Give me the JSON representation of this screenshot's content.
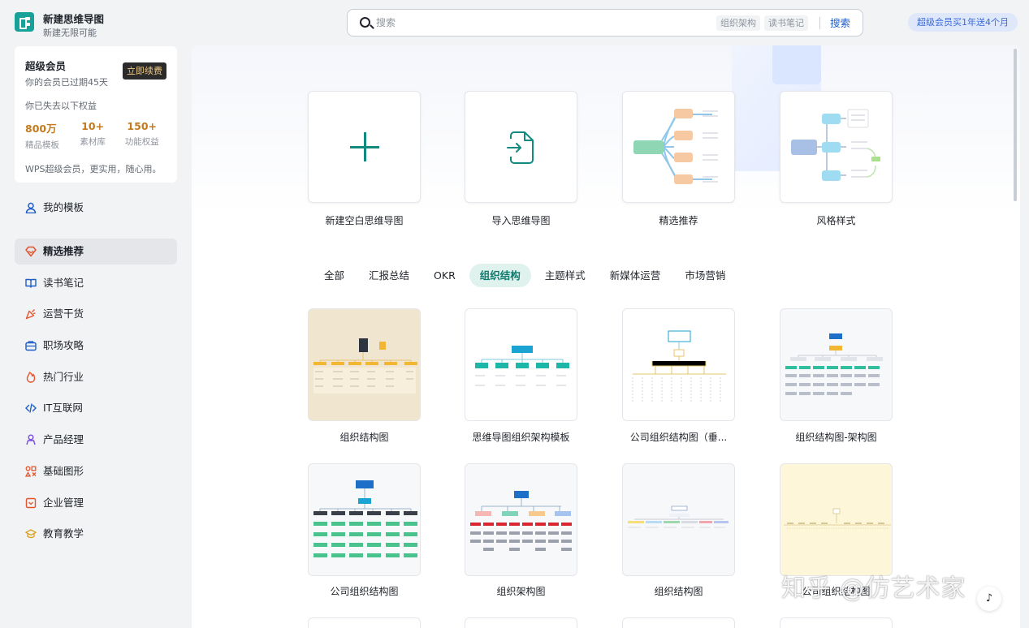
{
  "app": {
    "title": "新建思维导图",
    "subtitle": "新建无限可能"
  },
  "search": {
    "placeholder": "搜索",
    "tags": [
      "组织架构",
      "读书笔记"
    ],
    "button": "搜索"
  },
  "promo": "超级会员买1年送4个月",
  "member": {
    "title": "超级会员",
    "expired": "你的会员已过期45天",
    "renew": "立即续费",
    "lost": "你已失去以下权益",
    "stats": [
      {
        "value": "800万",
        "label": "精品模板"
      },
      {
        "value": "10+",
        "label": "素材库"
      },
      {
        "value": "150+",
        "label": "功能权益"
      }
    ],
    "slogan": "WPS超级会员，更实用，随心用。"
  },
  "nav": [
    {
      "label": "我的模板",
      "icon": "user-icon",
      "color": "#1e5cc8"
    },
    {
      "label": "精选推荐",
      "icon": "gem-icon",
      "color": "#e5532c",
      "active": true
    },
    {
      "label": "读书笔记",
      "icon": "book-icon",
      "color": "#1e5cc8"
    },
    {
      "label": "运营干货",
      "icon": "party-icon",
      "color": "#e5532c"
    },
    {
      "label": "职场攻略",
      "icon": "briefcase-icon",
      "color": "#1e5cc8"
    },
    {
      "label": "热门行业",
      "icon": "fire-icon",
      "color": "#e5532c"
    },
    {
      "label": "IT互联网",
      "icon": "code-icon",
      "color": "#1e5cc8"
    },
    {
      "label": "产品经理",
      "icon": "person-icon",
      "color": "#7a4be0"
    },
    {
      "label": "基础图形",
      "icon": "shapes-icon",
      "color": "#e5532c"
    },
    {
      "label": "企业管理",
      "icon": "calendar-icon",
      "color": "#e5532c"
    },
    {
      "label": "教育教学",
      "icon": "graduation-cap-icon",
      "color": "#d9a01b"
    }
  ],
  "top_cards": [
    {
      "label": "新建空白思维导图"
    },
    {
      "label": "导入思维导图"
    },
    {
      "label": "精选推荐"
    },
    {
      "label": "风格样式"
    }
  ],
  "tabs": [
    "全部",
    "汇报总结",
    "OKR",
    "组织结构",
    "主题样式",
    "新媒体运营",
    "市场营销"
  ],
  "active_tab": "组织结构",
  "templates": [
    {
      "title": "组织结构图"
    },
    {
      "title": "思维导图组织架构模板"
    },
    {
      "title": "公司组织结构图（垂..."
    },
    {
      "title": "组织结构图-架构图"
    },
    {
      "title": "公司组织结构图"
    },
    {
      "title": "组织架构图"
    },
    {
      "title": "组织结构图"
    },
    {
      "title": "公司组织结构图"
    }
  ],
  "watermark": "知乎 @仿艺术家",
  "colors": {
    "accent": "#0f7b6f",
    "link": "#1e5cc8",
    "gold": "#c37a1c"
  }
}
